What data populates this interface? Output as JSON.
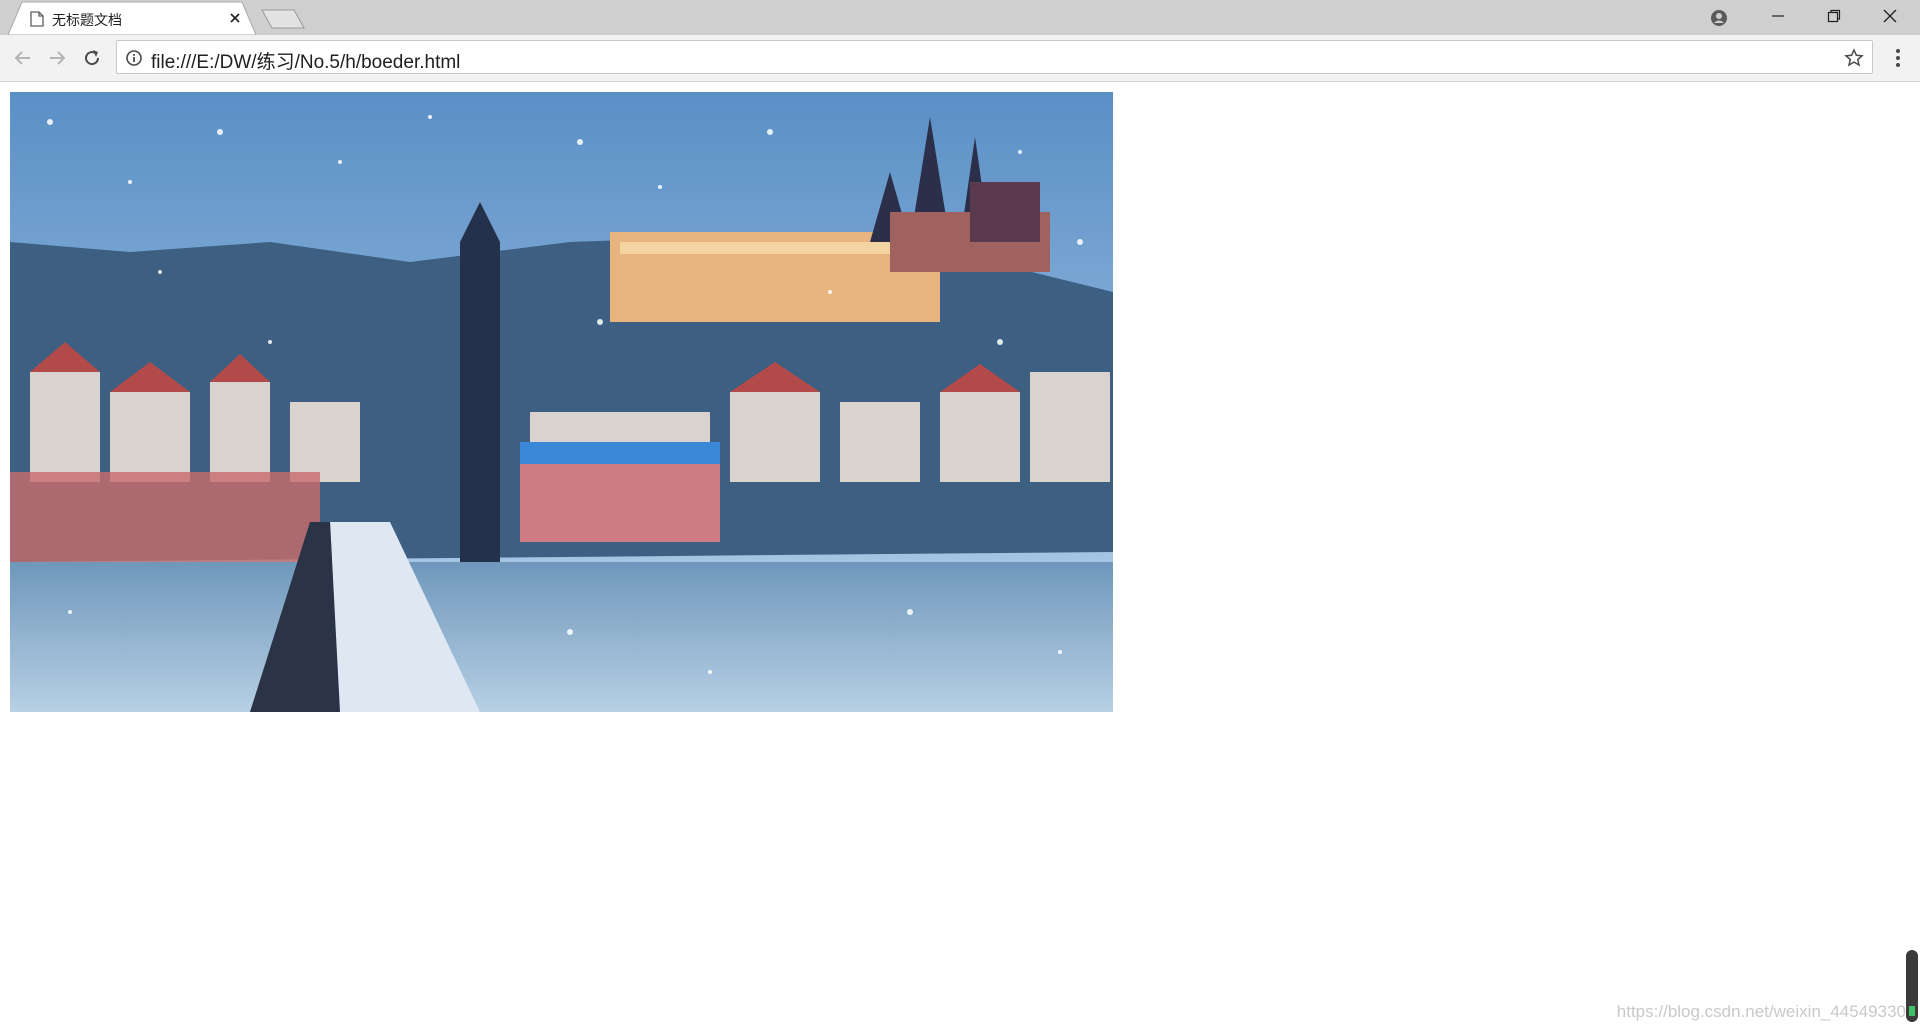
{
  "browser": {
    "tab": {
      "title": "无标题文档",
      "icon": "document-icon"
    },
    "new_tab_icon": "new-tab-icon",
    "window_controls": [
      "minimize-icon",
      "restore-icon",
      "close-icon"
    ],
    "profile_icon": "account-circle-icon"
  },
  "toolbar": {
    "back_icon": "back-arrow-icon",
    "forward_icon": "forward-arrow-icon",
    "reload_icon": "reload-icon",
    "address": {
      "url": "file:///E:/DW/练习/No.5/h/boeder.html",
      "info_icon": "info-icon",
      "bookmark_icon": "star-icon"
    },
    "menu_icon": "more-vert-icon"
  },
  "page": {
    "image_subject": "snowy city by river with castle",
    "watermark": "https://blog.csdn.net/weixin_44549330"
  },
  "colors": {
    "tabstrip": "#cfcfcf",
    "toolbar": "#f2f2f2",
    "page_bg": "#ffffff"
  }
}
